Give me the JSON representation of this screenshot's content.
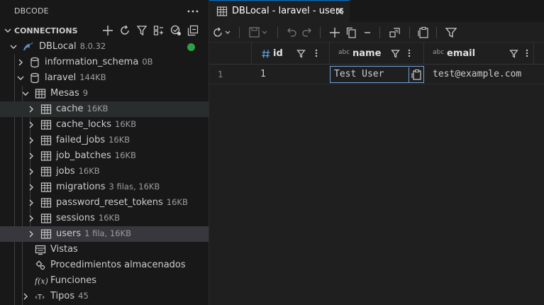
{
  "sidebar": {
    "title": "DBCODE",
    "section_title": "CONNECTIONS",
    "tools": [
      "add-icon",
      "refresh-icon",
      "filter-icon",
      "group-icon",
      "settings-sync-icon",
      "collapse-all-icon"
    ]
  },
  "tree": {
    "connection": {
      "label": "DBLocal",
      "meta": "8.0.32",
      "status_color": "#2ea043"
    },
    "schemas": [
      {
        "label": "information_schema",
        "meta": "0B"
      },
      {
        "label": "laravel",
        "meta": "144KB"
      }
    ],
    "tables_folder": {
      "label": "Mesas",
      "meta": "9"
    },
    "tables": [
      {
        "label": "cache",
        "meta": "16KB"
      },
      {
        "label": "cache_locks",
        "meta": "16KB"
      },
      {
        "label": "failed_jobs",
        "meta": "16KB"
      },
      {
        "label": "job_batches",
        "meta": "16KB"
      },
      {
        "label": "jobs",
        "meta": "16KB"
      },
      {
        "label": "migrations",
        "meta": "3 filas, 16KB"
      },
      {
        "label": "password_reset_tokens",
        "meta": "16KB"
      },
      {
        "label": "sessions",
        "meta": "16KB"
      },
      {
        "label": "users",
        "meta": "1 fila, 16KB"
      }
    ],
    "other": [
      {
        "label": "Vistas"
      },
      {
        "label": "Procedimientos almacenados"
      },
      {
        "label": "Funciones"
      },
      {
        "label": "Tipos",
        "meta": "45"
      }
    ]
  },
  "editor": {
    "tab_label": "DBLocal - laravel - users",
    "columns": [
      {
        "type": "#",
        "name": "id"
      },
      {
        "type": "abc",
        "name": "name"
      },
      {
        "type": "abc",
        "name": "email"
      }
    ],
    "rows": [
      {
        "num": "1",
        "id": "1",
        "name": "Test User",
        "email": "test@example.com"
      }
    ]
  },
  "colors": {
    "accent": "#0078d4",
    "edit_border": "#6ea2d8",
    "status": "#2ea043"
  }
}
